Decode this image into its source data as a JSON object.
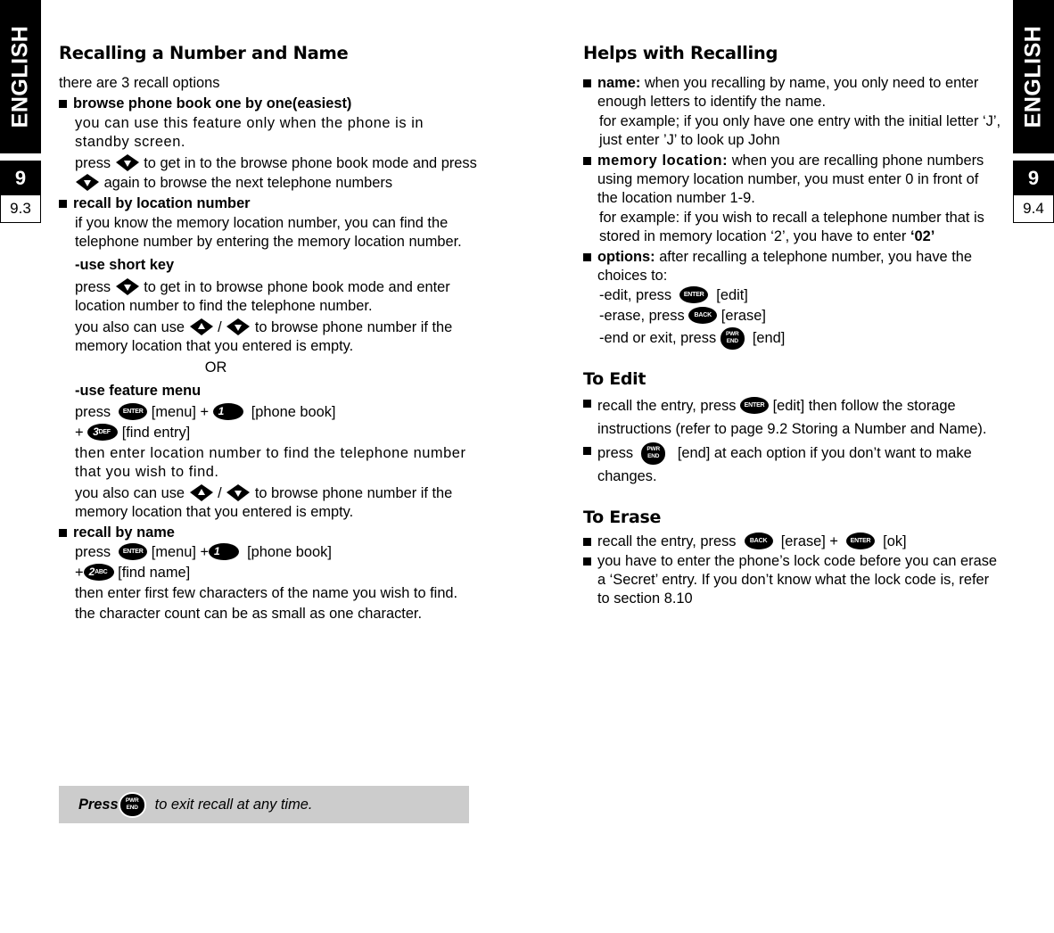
{
  "sidebars": {
    "left": {
      "language": "ENGLISH",
      "chapter": "9",
      "page": "9.3"
    },
    "right": {
      "language": "ENGLISH",
      "chapter": "9",
      "page": "9.4"
    }
  },
  "left_column": {
    "title": "Recalling a Number and Name",
    "intro": "there are 3 recall options",
    "b1_label": "browse phone book one by one(easiest)",
    "b1_p1": "you can use this feature only when the phone is in standby screen.",
    "b1_p2_a": "press",
    "b1_p2_b": "to get in to the browse phone book mode and press",
    "b1_p2_c": "again to browse the next telephone numbers",
    "b2_label": "recall by location number",
    "b2_p1": "if you know the memory location number, you can find the telephone number by entering the memory location number.",
    "short_key_head": "-use short key",
    "short_key_p1_a": "press",
    "short_key_p1_b": "to get in to browse phone book mode and enter location number to find the telephone number.",
    "short_key_p2_a": "you also can use",
    "short_key_p2_sep": "/",
    "short_key_p2_b": "to browse phone number if the memory location that you entered is empty.",
    "or": "OR",
    "feature_menu_head": "-use feature menu",
    "fm_press": "press",
    "fm_menu": "[menu]",
    "fm_plus": "+",
    "fm_phonebook": "[phone book]",
    "fm_plus2": "+",
    "fm_find_entry": "[find entry]",
    "fm_p1": "then enter location number to find the telephone number that you wish to find.",
    "fm_p2_a": "you also can use",
    "fm_p2_sep": "/",
    "fm_p2_b": "to browse phone number if the memory location that you entered is empty.",
    "b3_label": "recall by name",
    "name_press": "press",
    "name_menu": "[menu]",
    "name_plus": "+",
    "name_phonebook": "[phone book]",
    "name_plus2": "+",
    "name_find_name": "[find name]",
    "name_p1": "then enter first few characters of the name you wish to find.",
    "name_p2": "the character count can be as small as one character."
  },
  "note_box": {
    "press": "Press",
    "rest": "to exit recall at any time."
  },
  "right_column": {
    "title": "Helps with Recalling",
    "b1_label": "name:",
    "b1_text": " when you recalling by name, you only need to enter enough letters to identify the name.",
    "b1_p2": " for example; if you only have one entry with the initial letter ‘J’, just enter ’J’ to look up John",
    "b2_label": "memory location:",
    "b2_text": " when you are recalling phone numbers using memory location number, you must enter 0 in front of the location number 1-9.",
    "b2_p2a": "for example: if you wish to recall a telephone number that is stored in memory location ‘2’, you have to enter ",
    "b2_p2b": "‘02’",
    "b3_label": "options:",
    "b3_text": " after recalling a telephone number, you have the choices to:",
    "opt_edit_a": "-edit, press",
    "opt_edit_b": "[edit]",
    "opt_erase_a": "-erase, press",
    "opt_erase_b": "[erase]",
    "opt_end_a": "-end or exit, press",
    "opt_end_b": "[end]",
    "edit_title": "To Edit",
    "edit_b1_a": "recall the entry, press",
    "edit_b1_b": "[edit] then follow the storage instructions (refer to page 9.2 Storing a Number and Name).",
    "edit_b2_a": "press",
    "edit_b2_b": "[end] at each option if you don’t want to make changes.",
    "erase_title": "To Erase",
    "erase_b1_a": "recall the entry, press",
    "erase_b1_b": "[erase] +",
    "erase_b1_c": "[ok]",
    "erase_b2": "you have to enter the phone’s lock code before you can erase a ‘Secret’ entry. If you don’t know what the lock code is, refer to section 8.10"
  },
  "keys": {
    "enter": "ENTER",
    "back": "BACK",
    "pwr_l1": "PWR",
    "pwr_l2": "END",
    "digit1": "1",
    "digit2": "2",
    "digit2_sub": "ABC",
    "digit3": "3",
    "digit3_sub": "DEF"
  },
  "colors": {
    "ink": "#000000",
    "note_box_bg": "#cccccc",
    "page": "#ffffff"
  }
}
